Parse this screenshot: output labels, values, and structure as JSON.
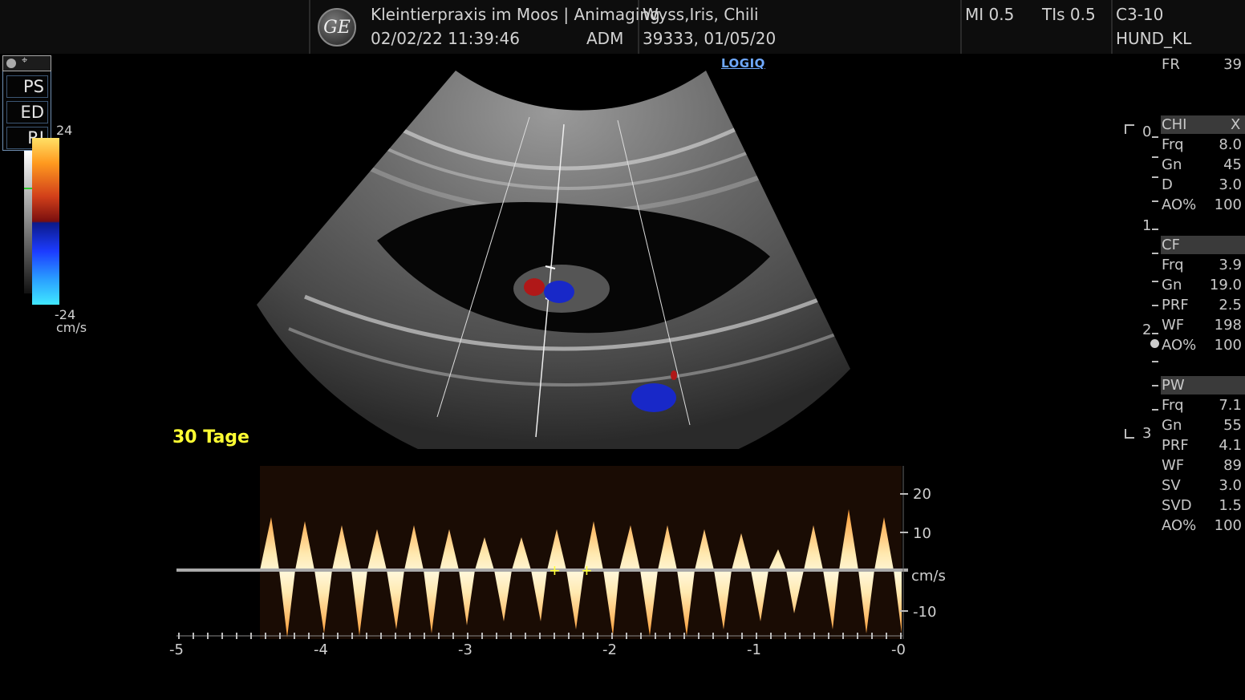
{
  "header": {
    "logo_text": "GE",
    "clinic": "Kleintierpraxis im Moos | Animaging",
    "datetime": "02/02/22 11:39:46",
    "operator": "ADM",
    "patient_name": "Wyss,Iris, Chili",
    "patient_id_dob": "39333, 01/05/20",
    "mi": "MI 0.5",
    "tis": "TIs 0.5",
    "probe": "C3-10",
    "preset": "HUND_KL"
  },
  "logiq_label": "LOGIQ",
  "measurement_menu": {
    "items": [
      "PS",
      "ED",
      "RI"
    ]
  },
  "color_scale": {
    "max": "24",
    "min": "-24",
    "unit": "cm/s"
  },
  "annotation": "30 Tage",
  "right_panel": {
    "fr_label": "FR",
    "fr_value": "39",
    "depth_ticks": [
      "0",
      "1",
      "2",
      "3"
    ],
    "chi": {
      "title": "CHI",
      "close": "X",
      "rows": [
        [
          "Frq",
          "8.0"
        ],
        [
          "Gn",
          "45"
        ],
        [
          "D",
          "3.0"
        ],
        [
          "AO%",
          "100"
        ]
      ]
    },
    "cf": {
      "title": "CF",
      "rows": [
        [
          "Frq",
          "3.9"
        ],
        [
          "Gn",
          "19.0"
        ],
        [
          "PRF",
          "2.5"
        ],
        [
          "WF",
          "198"
        ],
        [
          "AO%",
          "100"
        ]
      ]
    },
    "pw": {
      "title": "PW",
      "rows": [
        [
          "Frq",
          "7.1"
        ],
        [
          "Gn",
          "55"
        ],
        [
          "PRF",
          "4.1"
        ],
        [
          "WF",
          "89"
        ],
        [
          "SV",
          "3.0"
        ],
        [
          "SVD",
          "1.5"
        ],
        [
          "AO%",
          "100"
        ]
      ]
    }
  },
  "spectral": {
    "y_ticks": [
      "20",
      "10",
      "-10"
    ],
    "unit": "cm/s",
    "x_ticks": [
      "-5",
      "-4",
      "-3",
      "-2",
      "-1",
      "-0"
    ]
  },
  "colors": {
    "header_bg": "#0d0d0d",
    "annotation": "#ffff33",
    "logiq": "#6ea8ff",
    "doppler_red": "#b01818",
    "doppler_blue": "#1828c8"
  }
}
